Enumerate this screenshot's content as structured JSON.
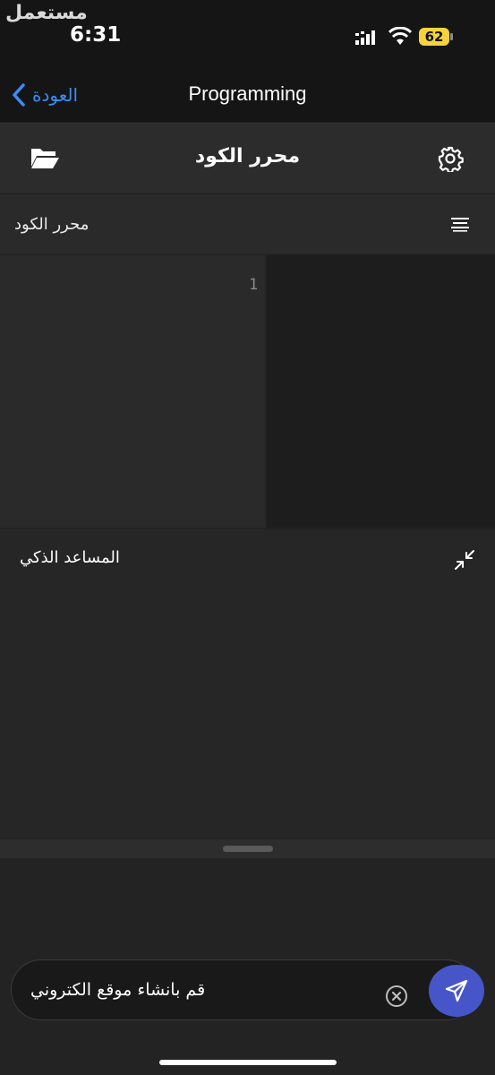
{
  "status_bar": {
    "watermark": "مستعمل",
    "time": "6:31",
    "battery": "62",
    "battery_color": "#f6d33c"
  },
  "nav": {
    "back_label": "العودة",
    "title": "Programming",
    "accent_color": "#3b8cf5"
  },
  "toolbar": {
    "title": "محرر الكود",
    "left_icon": "folder-open-icon",
    "right_icon": "gear-icon"
  },
  "editor": {
    "label": "محرر الكود",
    "menu_icon": "align-lines-icon",
    "line_numbers": [
      "1"
    ]
  },
  "assistant": {
    "label": "المساعد الذكي",
    "collapse_icon": "collapse-arrows-icon"
  },
  "composer": {
    "input_value": "قم بانشاء موقع الكتروني",
    "clear_icon": "clear-circle-icon",
    "send_icon": "send-icon",
    "send_color": "#4656c9"
  }
}
